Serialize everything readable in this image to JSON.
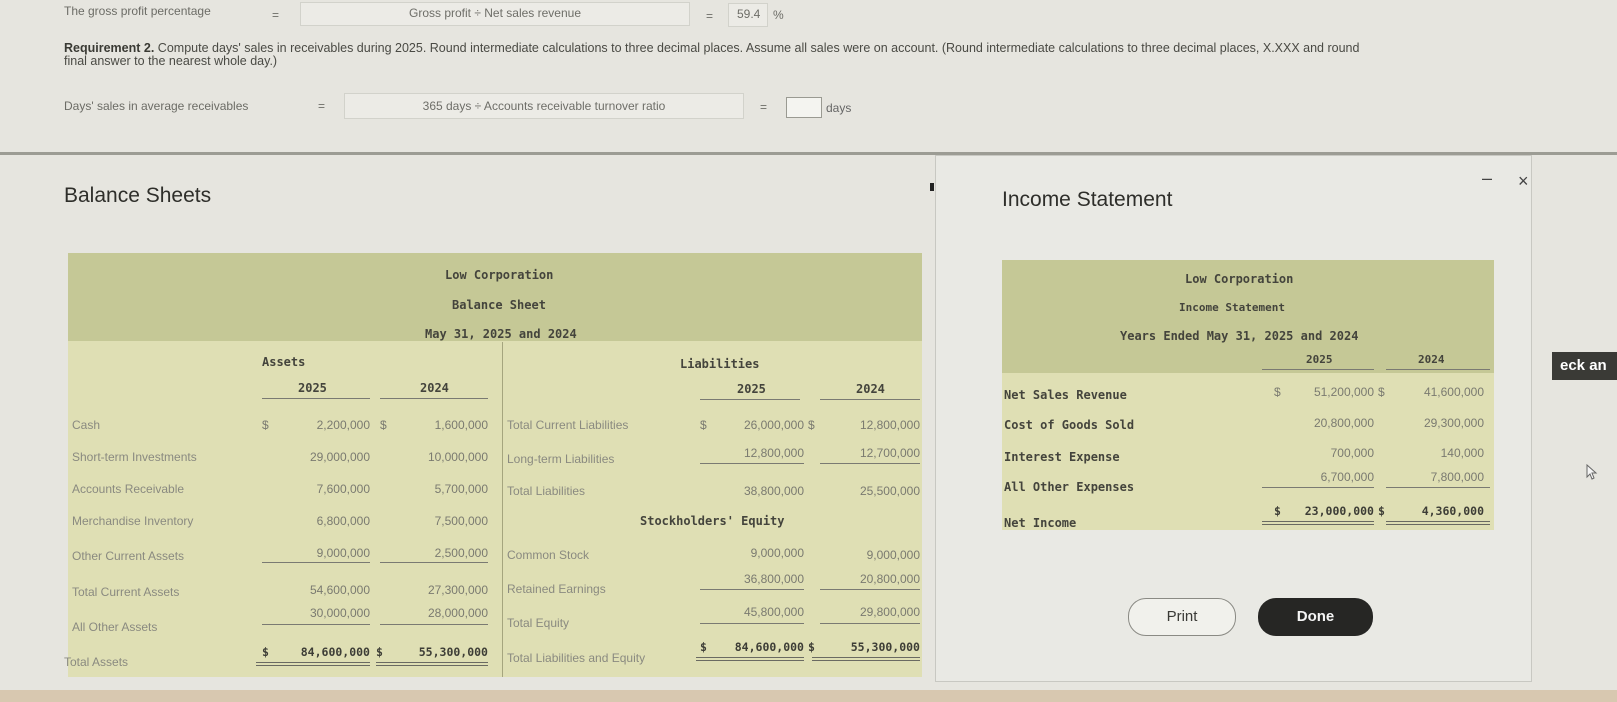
{
  "question": {
    "gross_profit_label": "The gross profit percentage",
    "gross_profit_eq": "=",
    "gross_profit_formula": "Gross profit ÷ Net sales revenue",
    "gross_profit_eq2": "=",
    "gross_profit_value": "59.4",
    "gross_profit_unit": "%",
    "requirement_label": "Requirement 2.",
    "requirement_text": "Compute days' sales in receivables during 2025. Round intermediate calculations to three decimal places. Assume all sales were on account. (Round intermediate calculations to three decimal places, X.XXX and round",
    "requirement_text2": "final answer to the nearest whole day.)",
    "days_label": "Days' sales in average receivables",
    "days_eq": "=",
    "days_formula": "365 days ÷ Accounts receivable turnover ratio",
    "days_eq2": "=",
    "days_value": "",
    "days_unit": "days"
  },
  "balance_sheet": {
    "panel_title": "Balance Sheets",
    "company": "Low Corporation",
    "statement": "Balance Sheet",
    "date": "May 31, 2025 and 2024",
    "assets_header": "Assets",
    "liabilities_header": "Liabilities",
    "equity_header": "Stockholders' Equity",
    "year1": "2025",
    "year2": "2024",
    "assets": [
      {
        "label": "Cash",
        "cur1": "$",
        "v2025": "2,200,000",
        "cur2": "$",
        "v2024": "1,600,000"
      },
      {
        "label": "Short-term Investments",
        "v2025": "29,000,000",
        "v2024": "10,000,000"
      },
      {
        "label": "Accounts Receivable",
        "v2025": "7,600,000",
        "v2024": "5,700,000"
      },
      {
        "label": "Merchandise Inventory",
        "v2025": "6,800,000",
        "v2024": "7,500,000"
      },
      {
        "label": "Other Current Assets",
        "v2025": "9,000,000",
        "v2024": "2,500,000"
      },
      {
        "label": "Total Current Assets",
        "v2025": "54,600,000",
        "v2024": "27,300,000"
      },
      {
        "label": "All Other Assets",
        "v2025": "30,000,000",
        "v2024": "28,000,000"
      },
      {
        "label": "Total Assets",
        "cur1": "$",
        "v2025": "84,600,000",
        "cur2": "$",
        "v2024": "55,300,000"
      }
    ],
    "liabilities": [
      {
        "label": "Total Current Liabilities",
        "cur1": "$",
        "v2025": "26,000,000",
        "cur2": "$",
        "v2024": "12,800,000"
      },
      {
        "label": "Long-term Liabilities",
        "v2025": "12,800,000",
        "v2024": "12,700,000"
      },
      {
        "label": "Total Liabilities",
        "v2025": "38,800,000",
        "v2024": "25,500,000"
      }
    ],
    "equity": [
      {
        "label": "Common Stock",
        "v2025": "9,000,000",
        "v2024": "9,000,000"
      },
      {
        "label": "Retained Earnings",
        "v2025": "36,800,000",
        "v2024": "20,800,000"
      },
      {
        "label": "Total Equity",
        "v2025": "45,800,000",
        "v2024": "29,800,000"
      },
      {
        "label": "Total Liabilities and Equity",
        "cur1": "$",
        "v2025": "84,600,000",
        "cur2": "$",
        "v2024": "55,300,000"
      }
    ]
  },
  "income_statement": {
    "panel_title": "Income Statement",
    "company": "Low Corporation",
    "statement": "Income Statement",
    "date": "Years Ended May 31, 2025 and 2024",
    "year1": "2025",
    "year2": "2024",
    "rows": [
      {
        "label": "Net Sales Revenue",
        "cur1": "$",
        "v2025": "51,200,000",
        "cur2": "$",
        "v2024": "41,600,000"
      },
      {
        "label": "Cost of Goods Sold",
        "v2025": "20,800,000",
        "v2024": "29,300,000"
      },
      {
        "label": "Interest Expense",
        "v2025": "700,000",
        "v2024": "140,000"
      },
      {
        "label": "All Other Expenses",
        "v2025": "6,700,000",
        "v2024": "7,800,000"
      },
      {
        "label": "Net Income",
        "cur1": "$",
        "v2025": "23,000,000",
        "cur2": "$",
        "v2024": "4,360,000"
      }
    ],
    "print_label": "Print",
    "done_label": "Done",
    "close_glyph": "×",
    "minimize_glyph": "–"
  },
  "side_tab": "eck an"
}
